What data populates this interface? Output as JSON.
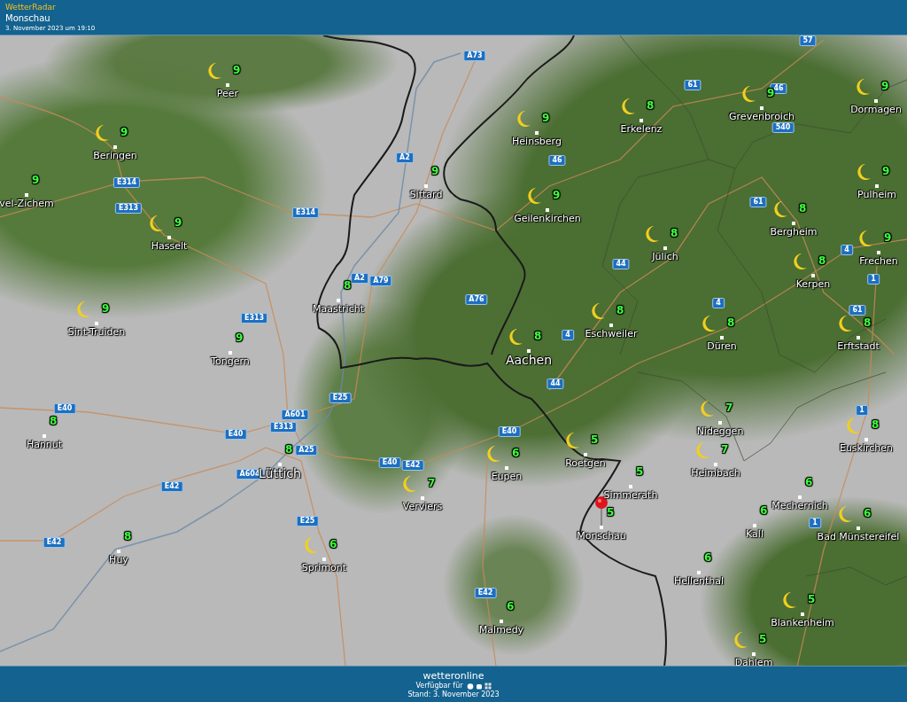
{
  "header": {
    "app_name": "WetterRadar",
    "location": "Monschau",
    "timestamp": "3. November 2023 um 19:10"
  },
  "map": {
    "cities": [
      {
        "name": "Peer",
        "temp": "9",
        "moon": true,
        "kind": "town"
      },
      {
        "name": "Beringen",
        "temp": "9",
        "moon": true,
        "kind": "town"
      },
      {
        "name": "Hasselt",
        "temp": "9",
        "moon": true,
        "kind": "town"
      },
      {
        "name": "Sint-Truiden",
        "temp": "9",
        "moon": true,
        "kind": "town"
      },
      {
        "name": "Tongern",
        "temp": "9",
        "moon": false,
        "kind": "town"
      },
      {
        "name": "Maastricht",
        "temp": "8",
        "moon": false,
        "kind": "town"
      },
      {
        "name": "Sittard",
        "temp": "9",
        "moon": false,
        "kind": "town"
      },
      {
        "name": "Heinsberg",
        "temp": "9",
        "moon": true,
        "kind": "town"
      },
      {
        "name": "Erkelenz",
        "temp": "8",
        "moon": true,
        "kind": "town"
      },
      {
        "name": "Grevenbroich",
        "temp": "9",
        "moon": true,
        "kind": "town"
      },
      {
        "name": "Dormagen",
        "temp": "9",
        "moon": true,
        "kind": "town"
      },
      {
        "name": "Geilenkirchen",
        "temp": "9",
        "moon": true,
        "kind": "town"
      },
      {
        "name": "Jülich",
        "temp": "8",
        "moon": true,
        "kind": "town"
      },
      {
        "name": "Bergheim",
        "temp": "8",
        "moon": true,
        "kind": "town"
      },
      {
        "name": "Pulheim",
        "temp": "9",
        "moon": true,
        "kind": "town"
      },
      {
        "name": "Frechen",
        "temp": "9",
        "moon": true,
        "kind": "town"
      },
      {
        "name": "Kerpen",
        "temp": "8",
        "moon": true,
        "kind": "town"
      },
      {
        "name": "Eschweiler",
        "temp": "8",
        "moon": true,
        "kind": "town"
      },
      {
        "name": "Aachen",
        "temp": "8",
        "moon": true,
        "kind": "city"
      },
      {
        "name": "Düren",
        "temp": "8",
        "moon": true,
        "kind": "town"
      },
      {
        "name": "Erftstadt",
        "temp": "8",
        "moon": true,
        "kind": "town"
      },
      {
        "name": "Hannut",
        "temp": "8",
        "moon": false,
        "kind": "town"
      },
      {
        "name": "Lüttich",
        "temp": "8",
        "moon": false,
        "kind": "city"
      },
      {
        "name": "Huy",
        "temp": "8",
        "moon": false,
        "kind": "town"
      },
      {
        "name": "Verviers",
        "temp": "7",
        "moon": true,
        "kind": "town"
      },
      {
        "name": "Sprimont",
        "temp": "6",
        "moon": true,
        "kind": "town"
      },
      {
        "name": "Eupen",
        "temp": "6",
        "moon": true,
        "kind": "town"
      },
      {
        "name": "Roetgen",
        "temp": "5",
        "moon": true,
        "kind": "town"
      },
      {
        "name": "Simmerath",
        "temp": "5",
        "moon": false,
        "kind": "town"
      },
      {
        "name": "Monschau",
        "temp": "5",
        "moon": false,
        "kind": "town"
      },
      {
        "name": "Nideggen",
        "temp": "7",
        "moon": true,
        "kind": "town"
      },
      {
        "name": "Heimbach",
        "temp": "7",
        "moon": true,
        "kind": "town"
      },
      {
        "name": "Mechernich",
        "temp": "6",
        "moon": false,
        "kind": "town"
      },
      {
        "name": "Euskirchen",
        "temp": "8",
        "moon": true,
        "kind": "town"
      },
      {
        "name": "Kall",
        "temp": "6",
        "moon": false,
        "kind": "town"
      },
      {
        "name": "Bad Münstereifel",
        "temp": "6",
        "moon": true,
        "kind": "town"
      },
      {
        "name": "Hellenthal",
        "temp": "6",
        "moon": false,
        "kind": "town"
      },
      {
        "name": "Malmedy",
        "temp": "6",
        "moon": false,
        "kind": "town"
      },
      {
        "name": "Blankenheim",
        "temp": "5",
        "moon": true,
        "kind": "town"
      },
      {
        "name": "Dahlem",
        "temp": "5",
        "moon": true,
        "kind": "town"
      },
      {
        "name": "vel-Zichem",
        "temp": "9",
        "moon": false,
        "kind": "town"
      }
    ],
    "road_signs": [
      "A73",
      "57",
      "61",
      "46",
      "540",
      "A2",
      "46",
      "E314",
      "E313",
      "E314",
      "61",
      "A2",
      "A79",
      "4",
      "44",
      "1",
      "A76",
      "4",
      "61",
      "E313",
      "4",
      "44",
      "E25",
      "E40",
      "A601",
      "E313",
      "E40",
      "1",
      "E40",
      "A25",
      "E40",
      "E42",
      "A604",
      "E42",
      "E25",
      "E42",
      "1",
      "E42"
    ]
  },
  "footer": {
    "logo": "wetteronline",
    "availability": "Verfügbar für",
    "updated": "Stand: 3. November 2023"
  }
}
